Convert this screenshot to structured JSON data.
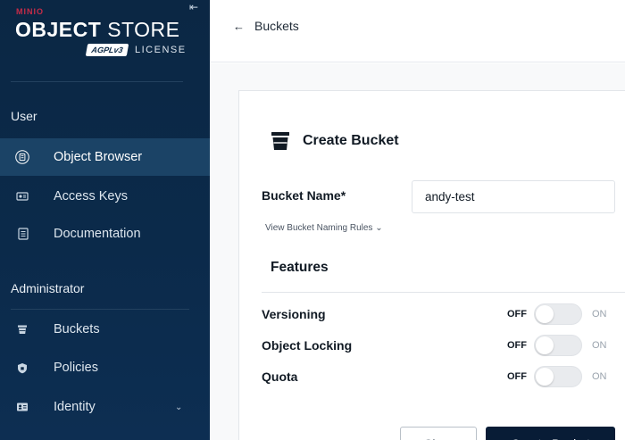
{
  "brand": {
    "minio": "MINIO",
    "object": "OBJECT",
    "store": "STORE",
    "agpl": "AGPLv3",
    "license": "LICENSE"
  },
  "sidebar": {
    "collapse_icon": "collapse-left-icon",
    "sections": [
      {
        "title": "User",
        "items": [
          {
            "label": "Object Browser",
            "icon": "object-browser-icon",
            "active": true
          },
          {
            "label": "Access Keys",
            "icon": "access-keys-icon",
            "active": false
          },
          {
            "label": "Documentation",
            "icon": "documentation-icon",
            "active": false
          }
        ]
      },
      {
        "title": "Administrator",
        "items": [
          {
            "label": "Buckets",
            "icon": "buckets-icon",
            "active": false
          },
          {
            "label": "Policies",
            "icon": "policies-icon",
            "active": false
          },
          {
            "label": "Identity",
            "icon": "identity-icon",
            "active": false,
            "expandable": true
          }
        ]
      }
    ]
  },
  "header": {
    "back_label": "Buckets",
    "back_icon": "arrow-left-icon"
  },
  "form": {
    "title": "Create Bucket",
    "title_icon": "bucket-icon",
    "bucket_name_label": "Bucket Name*",
    "bucket_name_value": "andy-test",
    "naming_rules": "View Bucket Naming Rules ⌄",
    "features_title": "Features",
    "toggles": [
      {
        "label": "Versioning",
        "off": "OFF",
        "on": "ON",
        "state": "off"
      },
      {
        "label": "Object Locking",
        "off": "OFF",
        "on": "ON",
        "state": "off"
      },
      {
        "label": "Quota",
        "off": "OFF",
        "on": "ON",
        "state": "off"
      }
    ],
    "clear_label": "Clear",
    "create_label": "Create Bucket"
  },
  "colors": {
    "sidebar_bg": "#0b2744",
    "sidebar_active": "#1b4366",
    "primary_button": "#081c36",
    "brand_red": "#c72c48"
  }
}
